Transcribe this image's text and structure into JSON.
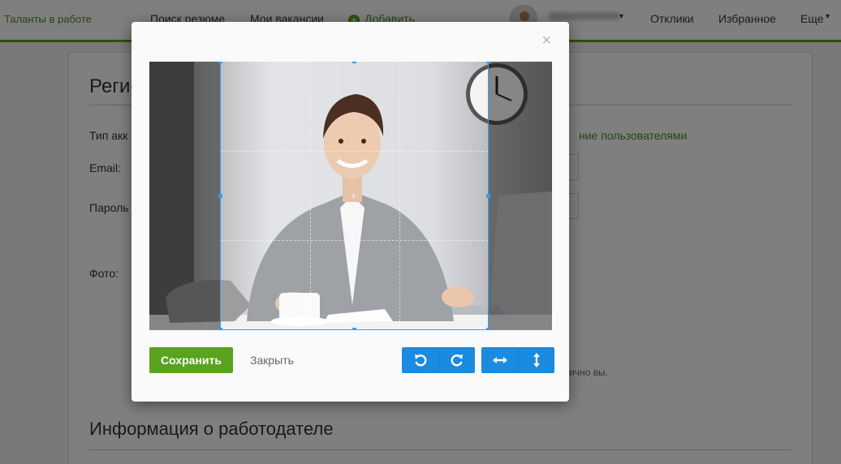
{
  "header": {
    "brand": "Таланты в работе",
    "nav": {
      "search_resumes": "Поиск резюме",
      "my_vacancies": "Мои вакансии",
      "add": "Добавить",
      "responses": "Отклики",
      "favorites": "Избранное",
      "more": "Еще"
    },
    "caret": "▾"
  },
  "page": {
    "section_registration": "Регис",
    "account_type_label": "Тип акк",
    "users_link": "ние пользователями",
    "email_label": "Email:",
    "password_label": "Пароль",
    "photo_label": "Фото:",
    "note_text": "ично вы.",
    "section_employer": "Информация о работодателе"
  },
  "modal": {
    "close_symbol": "×",
    "save_label": "Сохранить",
    "close_label": "Закрыть",
    "tools": [
      "rotate-left-icon",
      "rotate-right-icon",
      "flip-horizontal-icon",
      "flip-vertical-icon"
    ]
  },
  "colors": {
    "brand_green": "#5aa31f",
    "tool_blue": "#1a8be0",
    "crop_blue": "#3a9af0"
  }
}
